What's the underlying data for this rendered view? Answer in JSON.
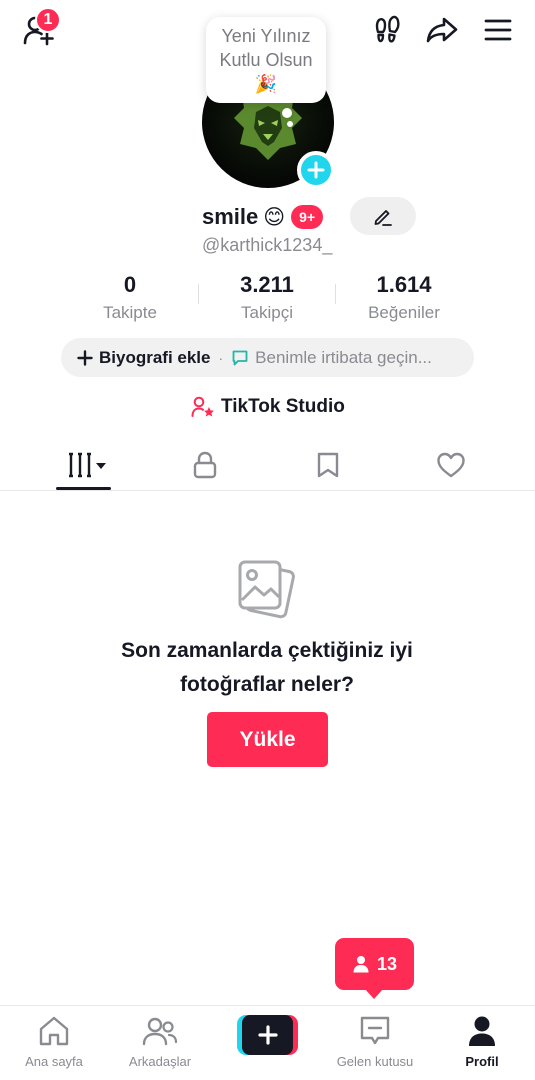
{
  "header": {
    "notification_count": "1"
  },
  "profile": {
    "note_text": "Yeni Yılınız Kutlu Olsun 🎉",
    "display_name": "smile",
    "name_emoji": "😊",
    "name_badge": "9+",
    "username": "@karthick1234_"
  },
  "stats": [
    {
      "value": "0",
      "label": "Takipte"
    },
    {
      "value": "3.211",
      "label": "Takipçi"
    },
    {
      "value": "1.614",
      "label": "Beğeniler"
    }
  ],
  "bio": {
    "add_label": "Biyografi ekle",
    "separator": "·",
    "contact_label": "Benimle irtibata geçin..."
  },
  "studio": {
    "label": "TikTok Studio"
  },
  "tabs": [
    {
      "icon": "grid-icon",
      "active": true
    },
    {
      "icon": "lock-icon",
      "active": false
    },
    {
      "icon": "bookmark-icon",
      "active": false
    },
    {
      "icon": "heart-icon",
      "active": false
    }
  ],
  "empty_state": {
    "icon": "photos-icon",
    "title": "Son zamanlarda çektiğiniz iyi fotoğraflar neler?",
    "button_label": "Yükle"
  },
  "toast": {
    "new_followers": "13"
  },
  "bottom_nav": {
    "home": "Ana sayfa",
    "friends": "Arkadaşlar",
    "inbox": "Gelen kutusu",
    "profile": "Profil"
  },
  "colors": {
    "accent": "#fe2c55",
    "cyan": "#20d5ec",
    "text": "#161823",
    "muted": "#8a8b91"
  }
}
